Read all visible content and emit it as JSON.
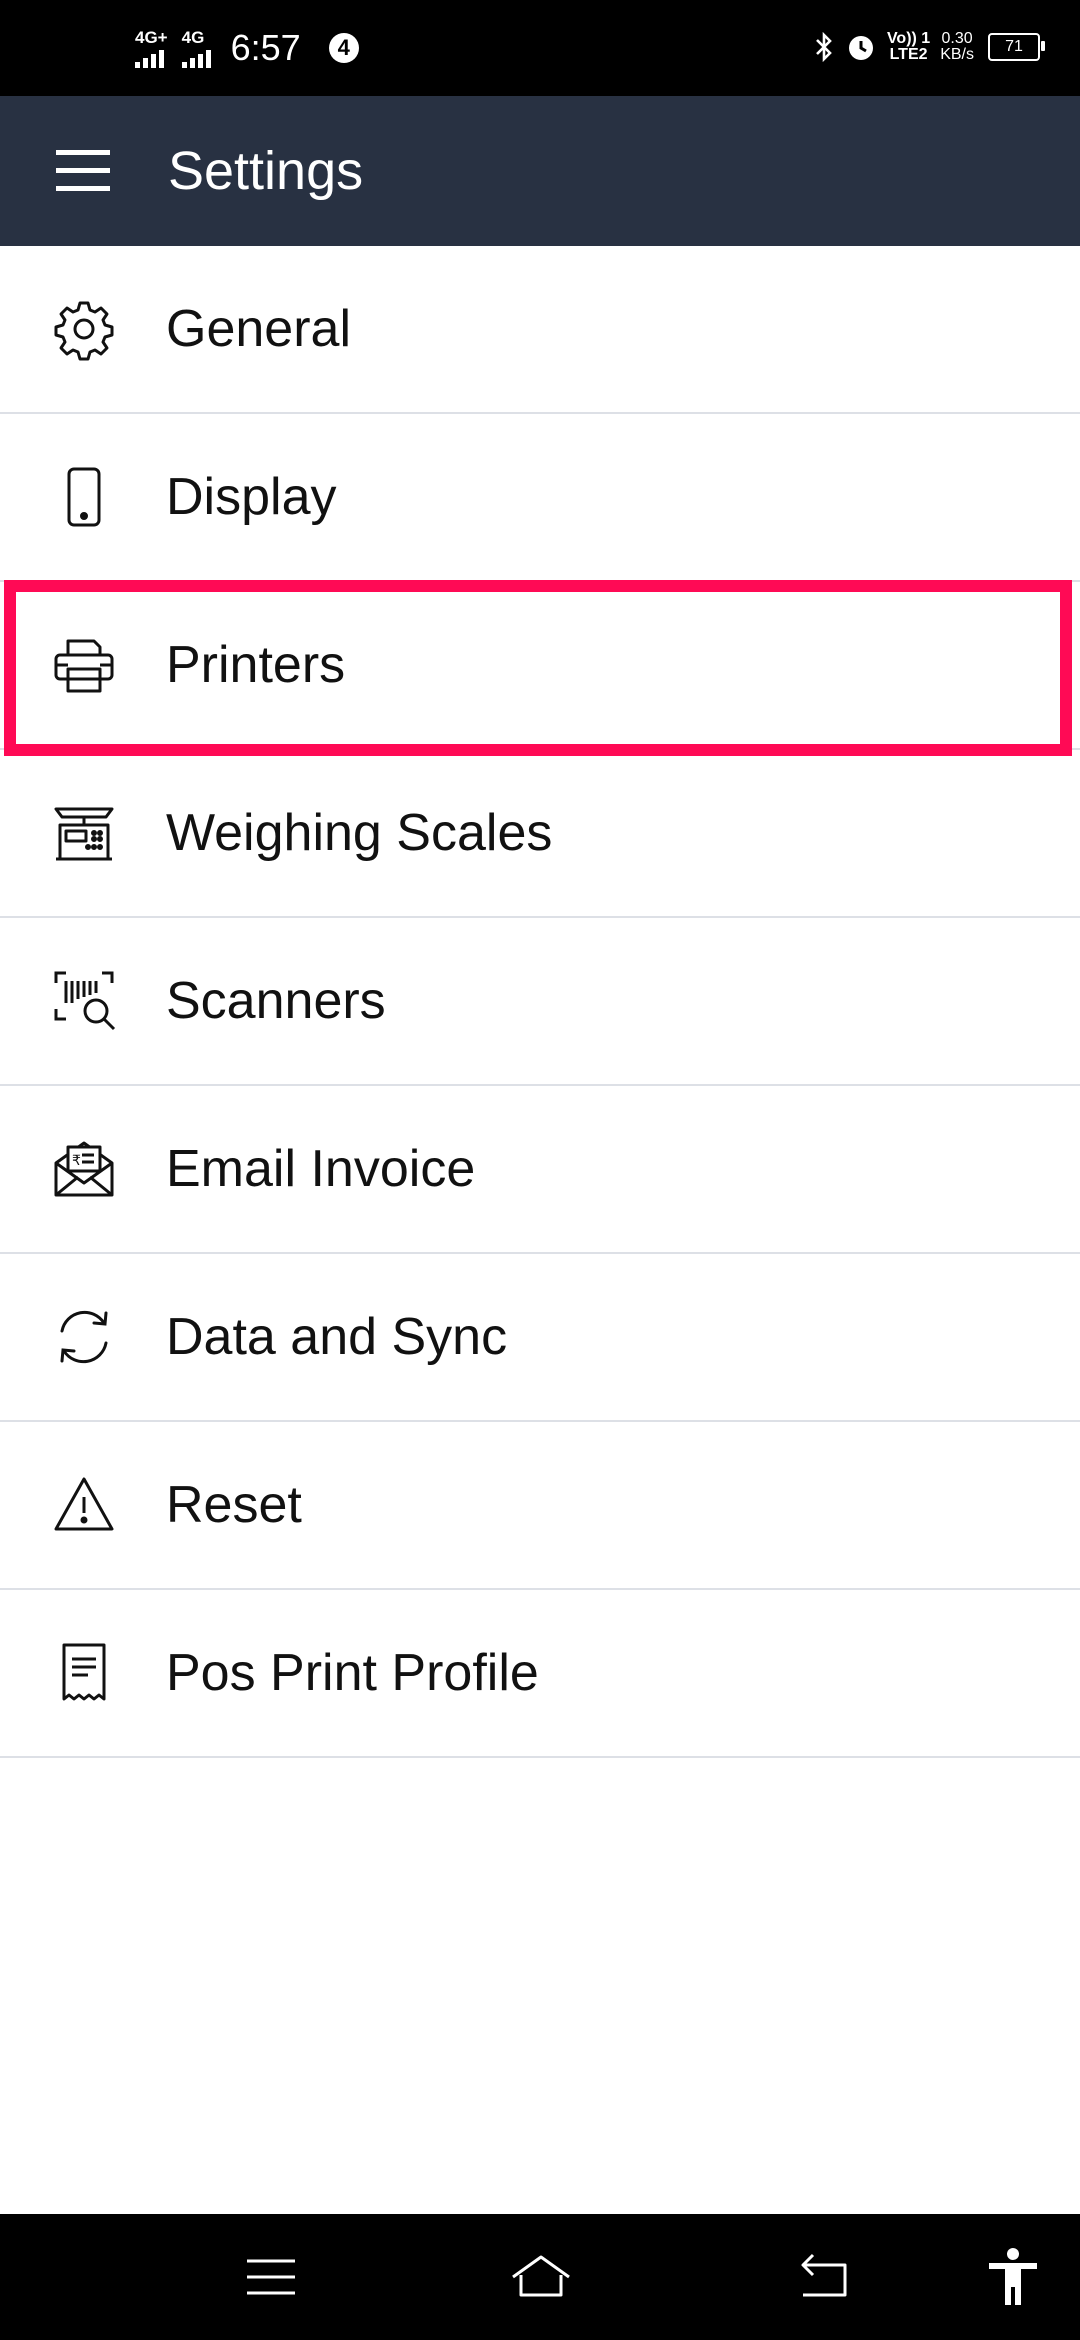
{
  "status_bar": {
    "network1": "4G+",
    "network2": "4G",
    "time": "6:57",
    "notification_count": "4",
    "volte_top": "Vo)) 1",
    "volte_bottom": "LTE2",
    "speed_value": "0.30",
    "speed_unit": "KB/s",
    "battery": "71"
  },
  "app_bar": {
    "title": "Settings",
    "menu_icon": "hamburger-menu-icon"
  },
  "settings": {
    "items": [
      {
        "label": "General",
        "icon": "gear-icon"
      },
      {
        "label": "Display",
        "icon": "phone-icon"
      },
      {
        "label": "Printers",
        "icon": "printer-icon"
      },
      {
        "label": "Weighing Scales",
        "icon": "weighing-scale-icon"
      },
      {
        "label": "Scanners",
        "icon": "barcode-scanner-icon"
      },
      {
        "label": "Email Invoice",
        "icon": "email-invoice-icon"
      },
      {
        "label": "Data and Sync",
        "icon": "sync-icon"
      },
      {
        "label": "Reset",
        "icon": "warning-icon"
      },
      {
        "label": "Pos Print Profile",
        "icon": "receipt-icon"
      }
    ],
    "highlighted_item": "Printers",
    "highlight_color": "#ff0a55"
  },
  "colors": {
    "app_bar": "#283142",
    "divider": "#dde0e6"
  },
  "nav_bar": {
    "buttons": [
      "menu-icon",
      "home-icon",
      "back-icon",
      "accessibility-icon"
    ]
  }
}
